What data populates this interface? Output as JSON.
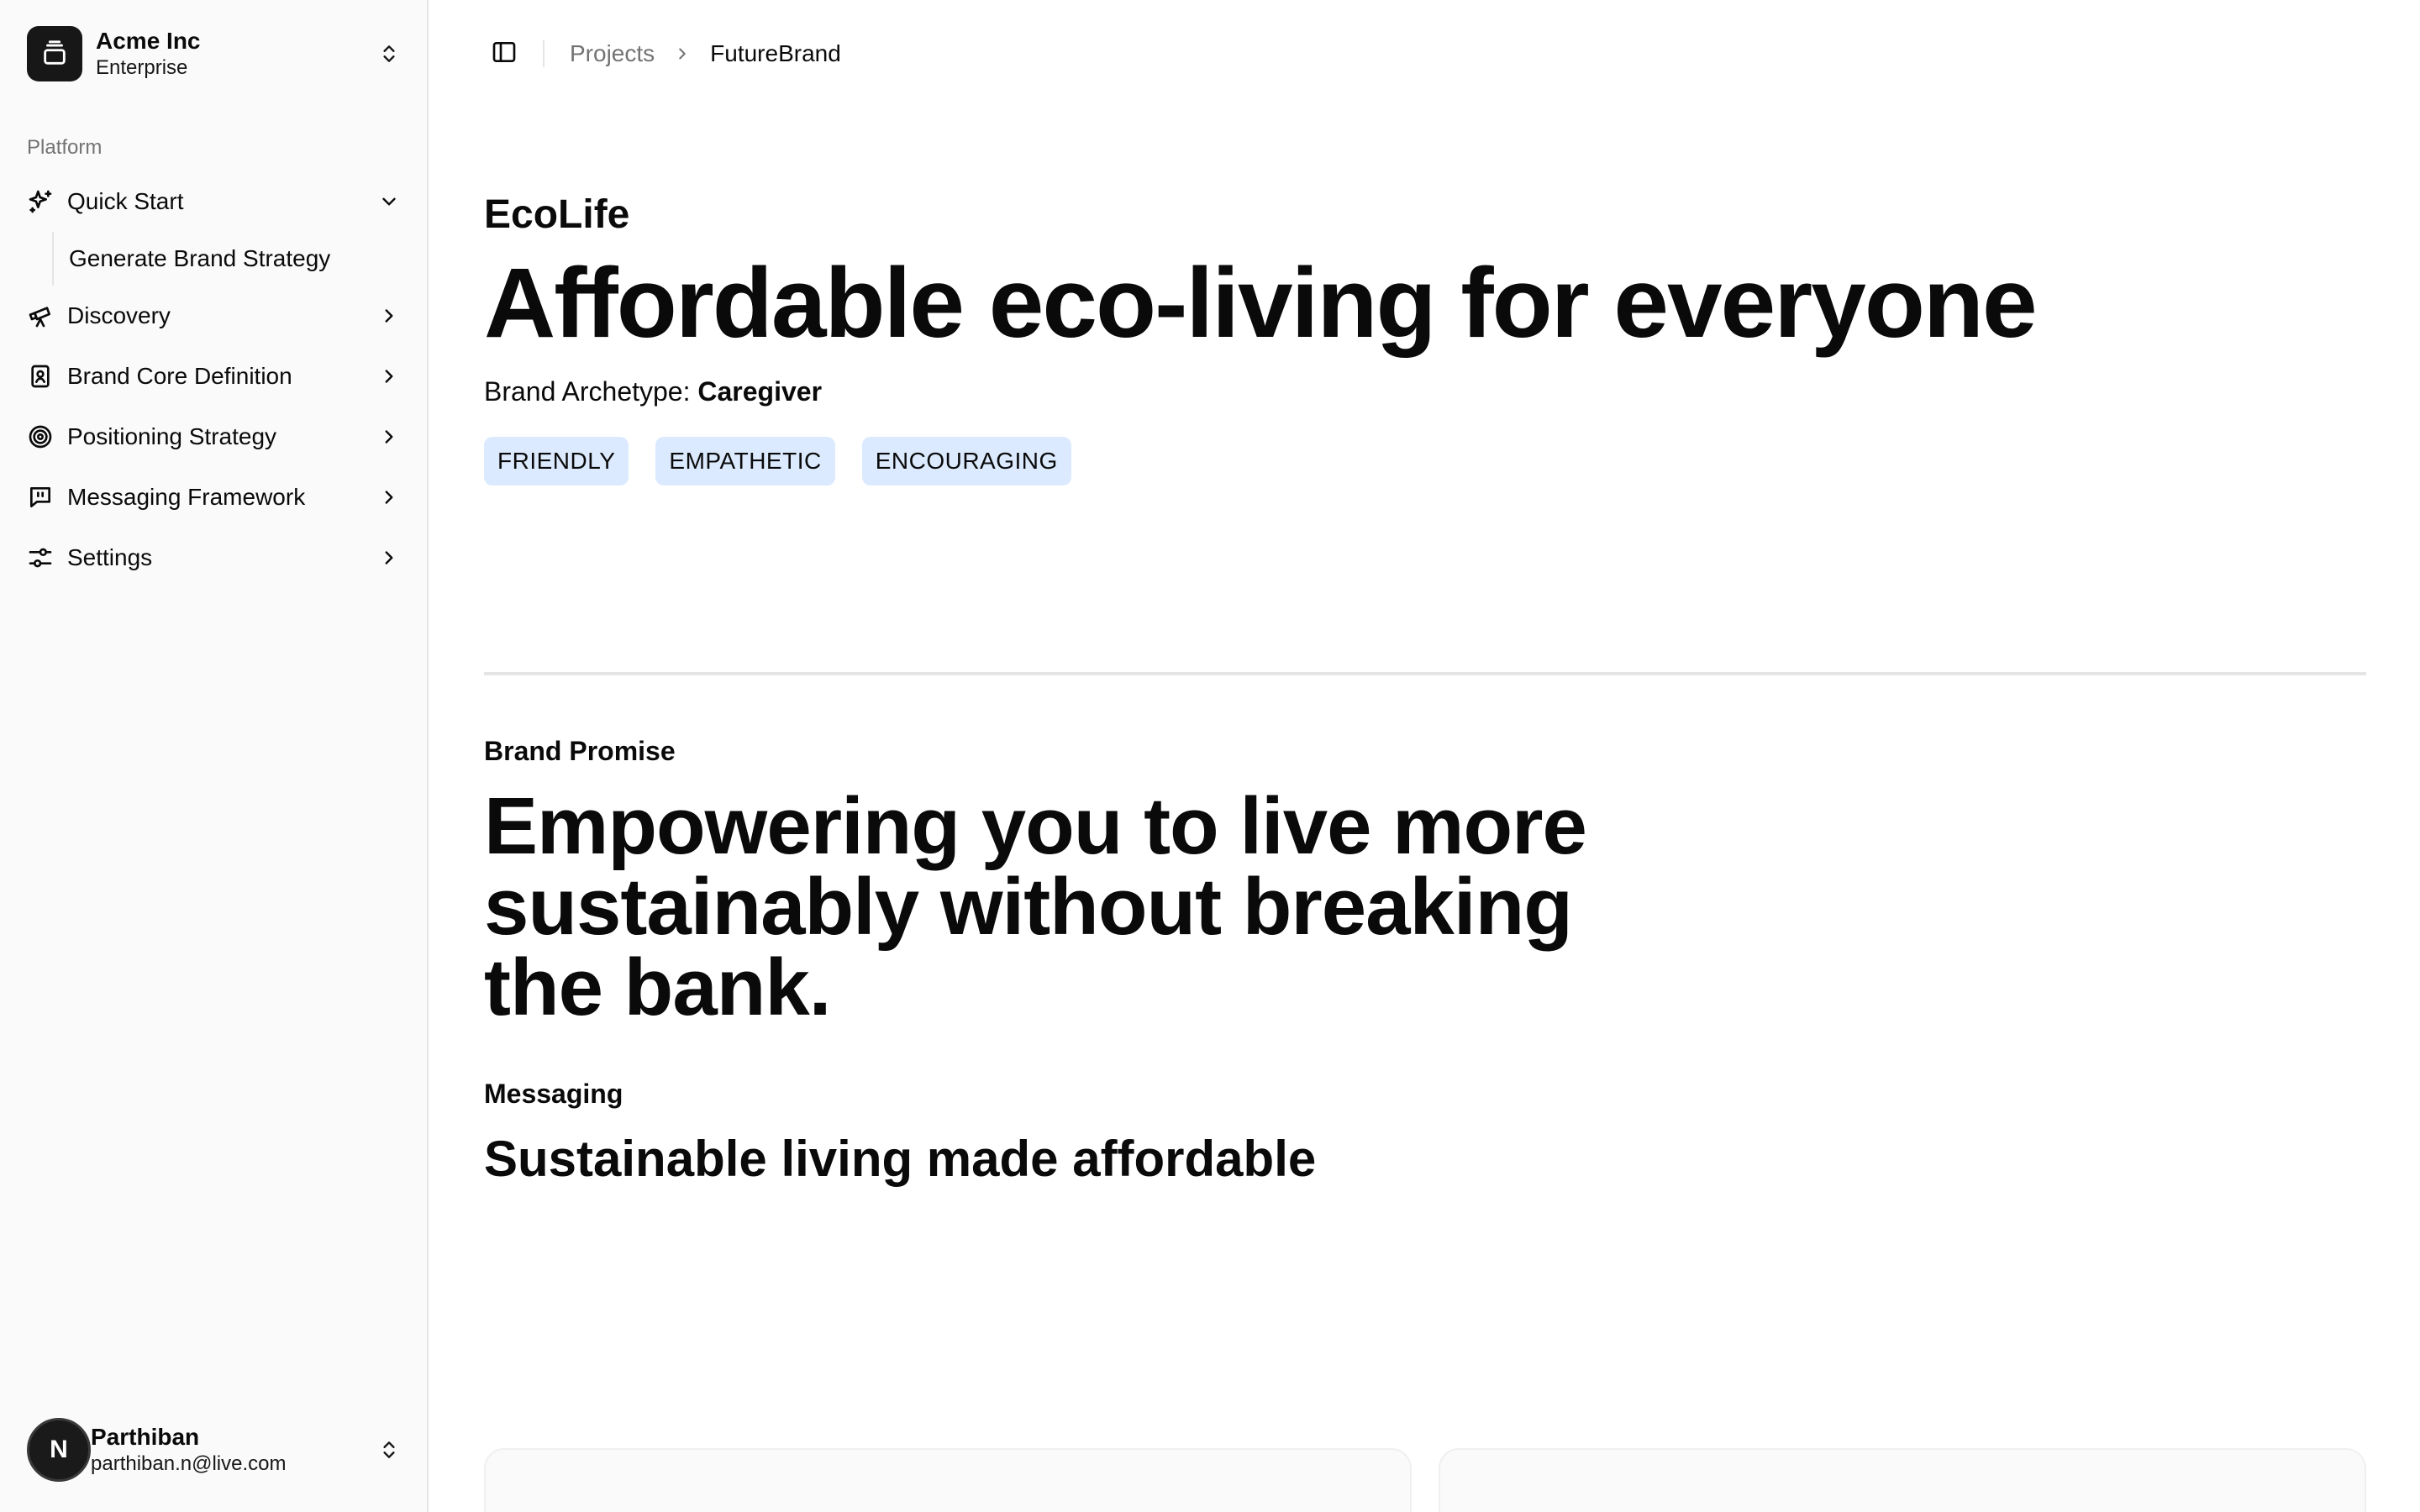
{
  "team": {
    "name": "Acme Inc",
    "plan": "Enterprise"
  },
  "sidebar": {
    "group_label": "Platform",
    "items": [
      {
        "label": "Quick Start",
        "icon": "sparkles-icon",
        "expanded": true
      },
      {
        "label": "Discovery",
        "icon": "telescope-icon"
      },
      {
        "label": "Brand Core Definition",
        "icon": "book-user-icon"
      },
      {
        "label": "Positioning Strategy",
        "icon": "target-icon"
      },
      {
        "label": "Messaging Framework",
        "icon": "message-quote-icon"
      },
      {
        "label": "Settings",
        "icon": "sliders-icon"
      }
    ],
    "sub_items": [
      {
        "label": "Generate Brand Strategy"
      }
    ]
  },
  "user": {
    "name": "Parthiban",
    "email": "parthiban.n@live.com",
    "initial": "N"
  },
  "breadcrumb": {
    "parent": "Projects",
    "current": "FutureBrand"
  },
  "brand": {
    "name": "EcoLife",
    "tagline": "Affordable eco-living for everyone",
    "archetype_label": "Brand Archetype: ",
    "archetype_value": "Caregiver",
    "tags": [
      "FRIENDLY",
      "EMPATHETIC",
      "ENCOURAGING"
    ]
  },
  "promise": {
    "label": "Brand Promise",
    "text": "Empowering you to live more sustainably without breaking the bank."
  },
  "messaging": {
    "label": "Messaging",
    "text": "Sustainable living made affordable"
  },
  "colors": {
    "tag_bg": "#dbeafe",
    "sidebar_bg": "#fafafa",
    "avatar_bg": "#1a1a1a"
  }
}
